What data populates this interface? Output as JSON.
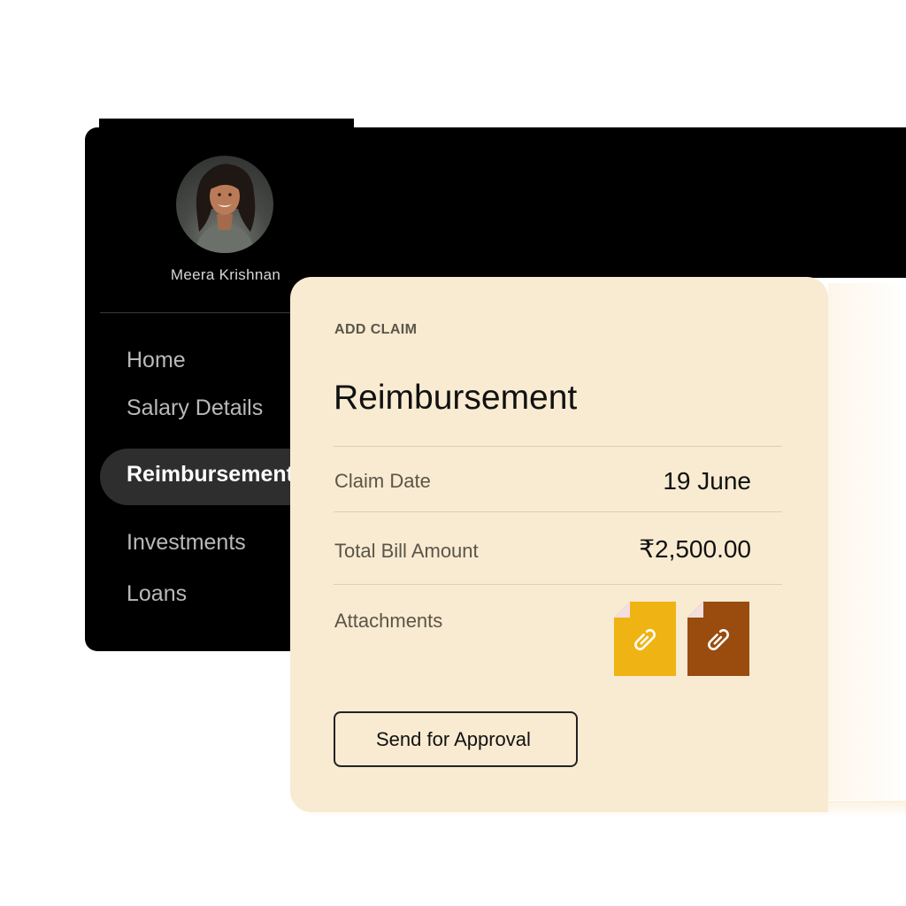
{
  "profile": {
    "name": "Meera Krishnan",
    "avatar_icon": "user-photo"
  },
  "sidebar": {
    "items": [
      {
        "label": "Home"
      },
      {
        "label": "Salary Details"
      },
      {
        "label": "Reimbursements",
        "active": true
      },
      {
        "label": "Investments"
      },
      {
        "label": "Loans"
      }
    ]
  },
  "claim": {
    "eyebrow": "ADD CLAIM",
    "title": "Reimbursement",
    "rows": [
      {
        "label": "Claim Date",
        "value": "19 June"
      },
      {
        "label": "Total Bill Amount",
        "value": "₹2,500.00"
      },
      {
        "label": "Attachments"
      }
    ],
    "attachments": [
      {
        "icon": "paperclip-icon",
        "color": "#efb414"
      },
      {
        "icon": "paperclip-icon",
        "color": "#994c0e"
      }
    ],
    "send_label": "Send for Approval"
  },
  "colors": {
    "sidebar_bg": "#000000",
    "active_pill": "#2e2e2e",
    "card_bg": "#f8ebd1"
  }
}
